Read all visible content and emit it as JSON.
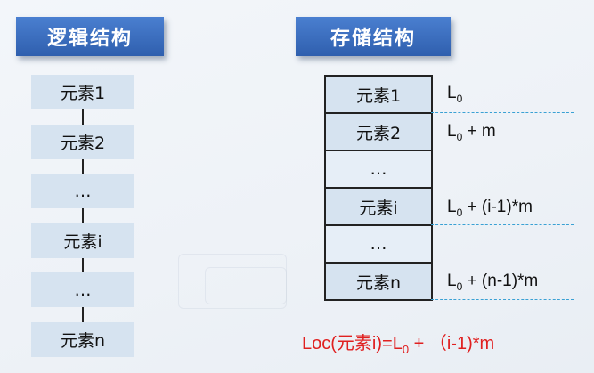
{
  "logical": {
    "title": "逻辑结构",
    "elements": [
      "元素1",
      "元素2",
      "…",
      "元素i",
      "…",
      "元素n"
    ]
  },
  "storage": {
    "title": "存储结构",
    "cells": [
      "元素1",
      "元素2",
      "…",
      "元素i",
      "…",
      "元素n"
    ],
    "addresses": [
      {
        "base": "L",
        "sub": "0",
        "rest": ""
      },
      {
        "base": "L",
        "sub": "0",
        "rest": " + m"
      },
      null,
      {
        "base": "L",
        "sub": "0",
        "rest": " + (i-1)*m"
      },
      null,
      {
        "base": "L",
        "sub": "0",
        "rest": " + (n-1)*m"
      }
    ]
  },
  "formula": {
    "pre": "Loc(元素i)=L",
    "sub": "0",
    "post": " + （i-1)*m"
  },
  "colors": {
    "banner": "#3a6cc0",
    "cell": "#d6e3f0",
    "formula": "#e02020",
    "dash": "#3aa1d4"
  }
}
